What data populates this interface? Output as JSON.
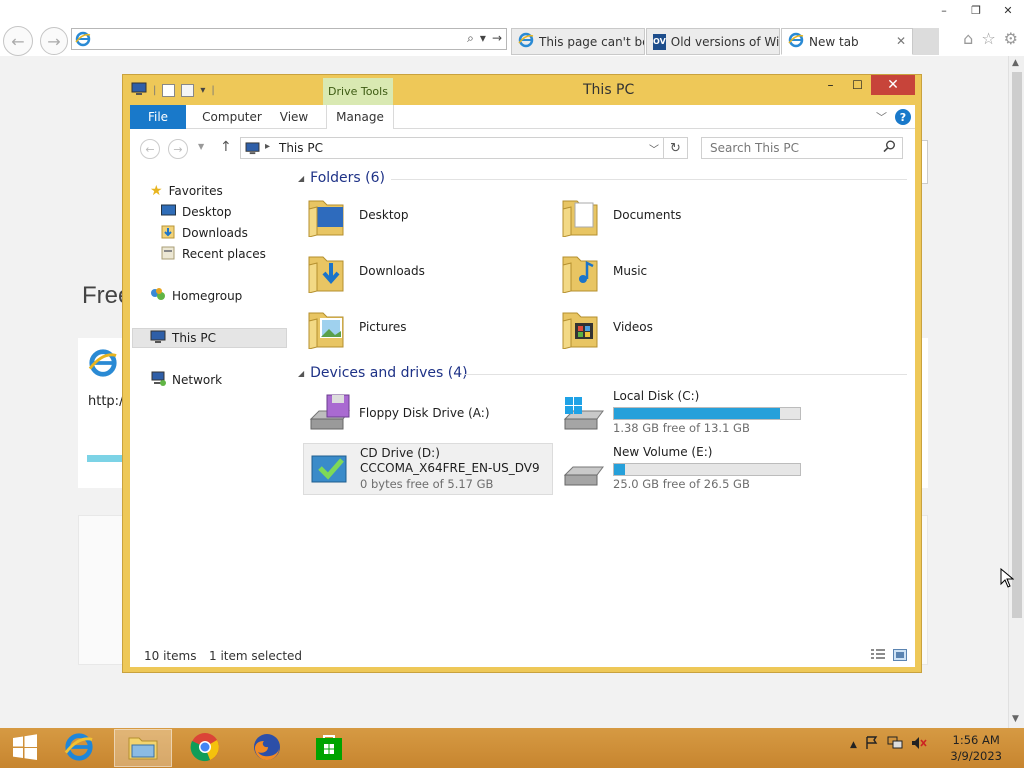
{
  "browser": {
    "window_buttons": [
      "–",
      "❐",
      "✕"
    ],
    "address_value": "",
    "address_tools": [
      "⌕",
      "▾",
      "→"
    ],
    "tabs": [
      {
        "label": "This page can't be...",
        "icon": "ie-icon",
        "active": false
      },
      {
        "label": "Old versions of Wi...",
        "icon": "ov-icon",
        "active": false
      },
      {
        "label": "New tab",
        "icon": "ie-icon",
        "active": true
      }
    ],
    "ov_icon_text": "OV",
    "tab_close": "✕",
    "right_icons": [
      "home-icon",
      "star-icon",
      "gear-icon"
    ]
  },
  "background_page": {
    "heading": "Free",
    "card_text": "http:/"
  },
  "explorer": {
    "title": "This PC",
    "window_buttons": [
      "–",
      "☐",
      "✕"
    ],
    "context_tab": "Drive Tools",
    "ribbon_tabs": [
      "File",
      "Computer",
      "View",
      "Manage"
    ],
    "help": "?",
    "breadcrumb": "This PC",
    "search_placeholder": "Search This PC",
    "nav": {
      "favorites": "Favorites",
      "desktop": "Desktop",
      "downloads": "Downloads",
      "recent": "Recent places",
      "homegroup": "Homegroup",
      "thispc": "This PC",
      "network": "Network"
    },
    "folders_header": "Folders (6)",
    "folders": [
      "Desktop",
      "Documents",
      "Downloads",
      "Music",
      "Pictures",
      "Videos"
    ],
    "devices_header": "Devices and drives (4)",
    "drives": [
      {
        "name": "Floppy Disk Drive (A:)"
      },
      {
        "name": "Local Disk (C:)",
        "free": "1.38 GB free of 13.1 GB",
        "used_fraction": 0.895
      },
      {
        "name": "CD Drive (D:)",
        "label": "CCCOMA_X64FRE_EN-US_DV9",
        "free": "0 bytes free of 5.17 GB"
      },
      {
        "name": "New Volume (E:)",
        "free": "25.0 GB free of 26.5 GB",
        "used_fraction": 0.057
      }
    ],
    "status": {
      "items": "10 items",
      "selected": "1 item selected"
    }
  },
  "taskbar": {
    "clock_time": "1:56 AM",
    "clock_date": "3/9/2023",
    "tray": [
      "▲"
    ]
  },
  "colors": {
    "explorer_frame": "#eec858",
    "taskbar": "#c98a34",
    "ribbon_file": "#1979ca",
    "drive_bar": "#26a0da",
    "close_button": "#c7443a"
  }
}
